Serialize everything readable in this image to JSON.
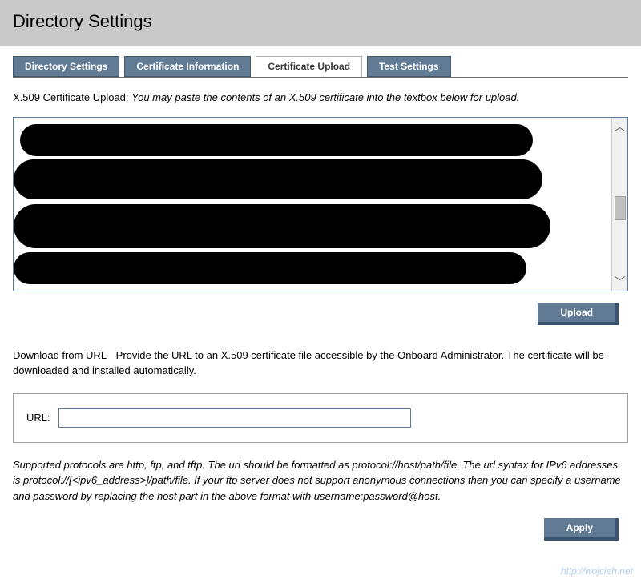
{
  "header": {
    "title": "Directory Settings"
  },
  "tabs": {
    "items": [
      {
        "label": "Directory Settings"
      },
      {
        "label": "Certificate Information"
      },
      {
        "label": "Certificate Upload"
      },
      {
        "label": "Test Settings"
      }
    ],
    "activeIndex": 2
  },
  "upload": {
    "lead": "X.509 Certificate Upload:",
    "desc": "You may paste the contents of an X.509 certificate into the textbox below for upload.",
    "textarea_value": "",
    "button": "Upload"
  },
  "download": {
    "lead": "Download from URL",
    "desc": "Provide the URL to an X.509 certificate file accessible by the Onboard Administrator. The certificate will be downloaded and installed automatically.",
    "url_label": "URL:",
    "url_value": "",
    "protocols_note": "Supported protocols are http, ftp, and tftp. The url should be formatted as protocol://host/path/file. The url syntax for IPv6 addresses is protocol://[<ipv6_address>]/path/file. If your ftp server does not support anonymous connections then you can specify a username and password by replacing the host part in the above format with username:password@host.",
    "button": "Apply"
  },
  "watermark": "http://wojcieh.net"
}
